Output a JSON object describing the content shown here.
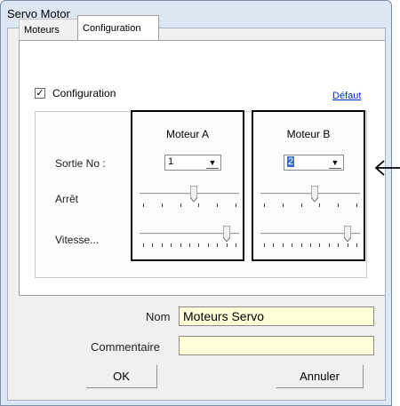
{
  "window": {
    "title": "Servo Motor"
  },
  "tabs": [
    {
      "label": "Moteurs"
    },
    {
      "label": "Configuration"
    }
  ],
  "config": {
    "checkbox_label": "Configuration",
    "checked": true,
    "check_mark": "✓",
    "default_link": "Défaut"
  },
  "rows": {
    "sortie": "Sortie No :",
    "arret": "Arrêt",
    "vitesse": "Vitesse..."
  },
  "motor_a": {
    "title": "Moteur A",
    "sortie_value": "1",
    "arret_level": 0.55,
    "vitesse_level": 0.9
  },
  "motor_b": {
    "title": "Moteur B",
    "sortie_value": "2",
    "arret_level": 0.55,
    "vitesse_level": 0.9
  },
  "form": {
    "nom_label": "Nom",
    "nom_value": "Moteurs Servo",
    "comment_label": "Commentaire",
    "comment_value": ""
  },
  "buttons": {
    "ok": "OK",
    "cancel": "Annuler"
  },
  "icons": {
    "combo_arrow": "▼"
  }
}
